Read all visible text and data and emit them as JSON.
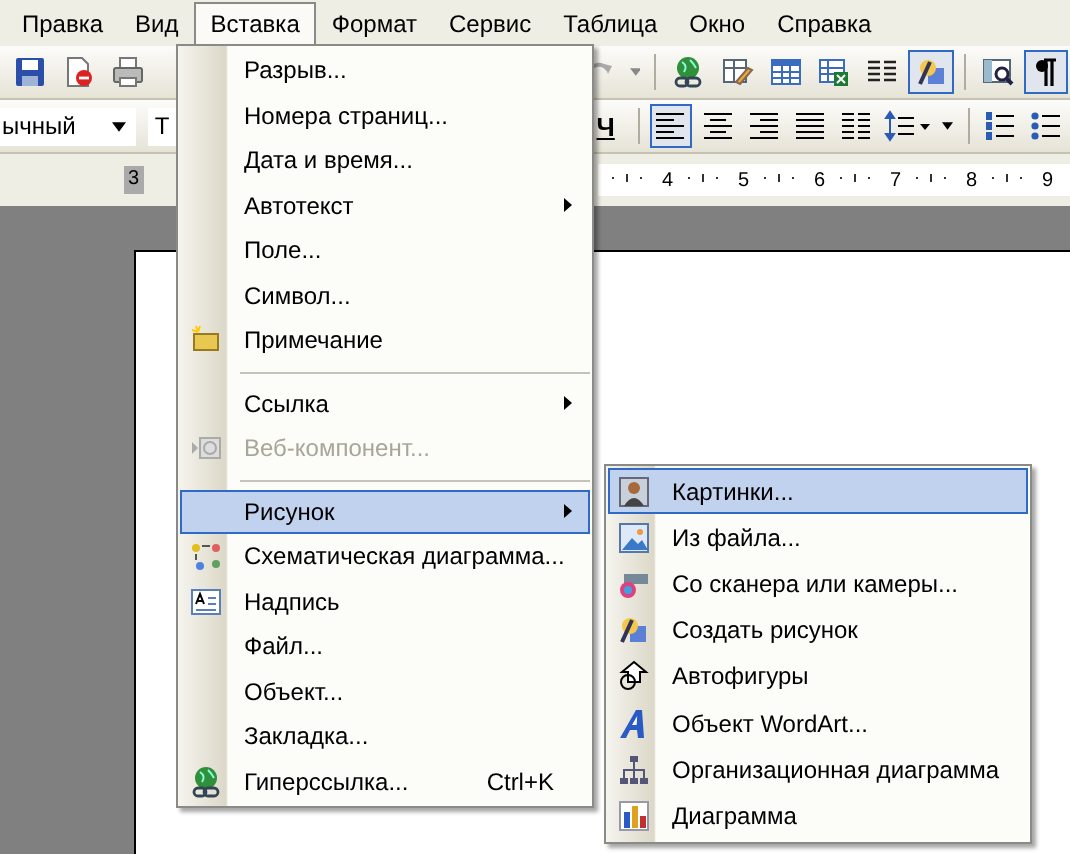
{
  "menu_bar": [
    {
      "label": "Правка",
      "selected": false
    },
    {
      "label": "Вид",
      "selected": false
    },
    {
      "label": "Вставка",
      "selected": true
    },
    {
      "label": "Формат",
      "selected": false
    },
    {
      "label": "Сервис",
      "selected": false
    },
    {
      "label": "Таблица",
      "selected": false
    },
    {
      "label": "Окно",
      "selected": false
    },
    {
      "label": "Справка",
      "selected": false
    }
  ],
  "standard_toolbar": {
    "left": [
      {
        "kind": "save"
      },
      {
        "kind": "permission"
      },
      {
        "kind": "print"
      }
    ],
    "right": [
      {
        "kind": "redo",
        "pressed": false
      },
      {
        "kind": "hyperlink",
        "pressed": false
      },
      {
        "kind": "tables-borders",
        "pressed": false
      },
      {
        "kind": "table",
        "pressed": false
      },
      {
        "kind": "spreadsheet",
        "pressed": false
      },
      {
        "kind": "columns",
        "pressed": false
      },
      {
        "kind": "drawing",
        "pressed": true
      },
      {
        "kind": "document-map",
        "pressed": false
      },
      {
        "kind": "pilcrow",
        "pressed": true
      }
    ]
  },
  "formatting_toolbar": {
    "style": "ычный",
    "font": "T",
    "underline": "Ч",
    "buttons": [
      {
        "kind": "align-left",
        "selected": true
      },
      {
        "kind": "align-center",
        "selected": false
      },
      {
        "kind": "align-right",
        "selected": false
      },
      {
        "kind": "justify",
        "selected": false
      },
      {
        "kind": "distribute",
        "selected": false
      },
      {
        "kind": "line-spacing",
        "selected": false
      },
      {
        "kind": "numbering",
        "selected": false
      },
      {
        "kind": "bullets",
        "selected": false
      }
    ]
  },
  "ruler": {
    "left_label": "3",
    "labels": [
      "4",
      "5",
      "6",
      "7",
      "8",
      "9"
    ]
  },
  "insert_menu": [
    {
      "label": "Разрыв...",
      "kind": "plain",
      "disabled": false,
      "submenu": false,
      "selected": false
    },
    {
      "label": "Номера страниц...",
      "kind": "plain",
      "disabled": false,
      "submenu": false,
      "selected": false
    },
    {
      "label": "Дата и время...",
      "kind": "plain",
      "disabled": false,
      "submenu": false,
      "selected": false
    },
    {
      "label": "Автотекст",
      "kind": "plain",
      "disabled": false,
      "submenu": true,
      "selected": false
    },
    {
      "label": "Поле...",
      "kind": "plain",
      "disabled": false,
      "submenu": false,
      "selected": false
    },
    {
      "label": "Символ...",
      "kind": "plain",
      "disabled": false,
      "submenu": false,
      "selected": false
    },
    {
      "label": "Примечание",
      "kind": "comment",
      "disabled": false,
      "submenu": false,
      "selected": false
    },
    {
      "kind": "separator"
    },
    {
      "label": "Ссылка",
      "kind": "plain",
      "disabled": false,
      "submenu": true,
      "selected": false
    },
    {
      "label": "Веб-компонент...",
      "kind": "web-component",
      "disabled": true,
      "submenu": false,
      "selected": false
    },
    {
      "kind": "separator"
    },
    {
      "label": "Рисунок",
      "kind": "plain",
      "disabled": false,
      "submenu": true,
      "selected": true
    },
    {
      "label": "Схематическая диаграмма...",
      "kind": "diagram",
      "disabled": false,
      "submenu": false,
      "selected": false
    },
    {
      "label": "Надпись",
      "kind": "textbox",
      "disabled": false,
      "submenu": false,
      "selected": false
    },
    {
      "label": "Файл...",
      "kind": "plain",
      "disabled": false,
      "submenu": false,
      "selected": false
    },
    {
      "label": "Объект...",
      "kind": "plain",
      "disabled": false,
      "submenu": false,
      "selected": false
    },
    {
      "label": "Закладка...",
      "kind": "plain",
      "disabled": false,
      "submenu": false,
      "selected": false
    },
    {
      "label": "Гиперссылка...",
      "kind": "hyperlink",
      "disabled": false,
      "submenu": false,
      "selected": false,
      "shortcut": "Ctrl+K"
    }
  ],
  "picture_submenu": [
    {
      "label": "Картинки...",
      "kind": "clipart",
      "selected": true
    },
    {
      "label": "Из файла...",
      "kind": "image",
      "selected": false
    },
    {
      "label": "Со сканера или камеры...",
      "kind": "scanner",
      "selected": false
    },
    {
      "label": "Создать рисунок",
      "kind": "drawing",
      "selected": false
    },
    {
      "label": "Автофигуры",
      "kind": "shapes",
      "selected": false
    },
    {
      "label": "Объект WordArt...",
      "kind": "wordart",
      "selected": false
    },
    {
      "label": "Организационная диаграмма",
      "kind": "org-chart",
      "selected": false
    },
    {
      "label": "Диаграмма",
      "kind": "chart",
      "selected": false
    }
  ]
}
